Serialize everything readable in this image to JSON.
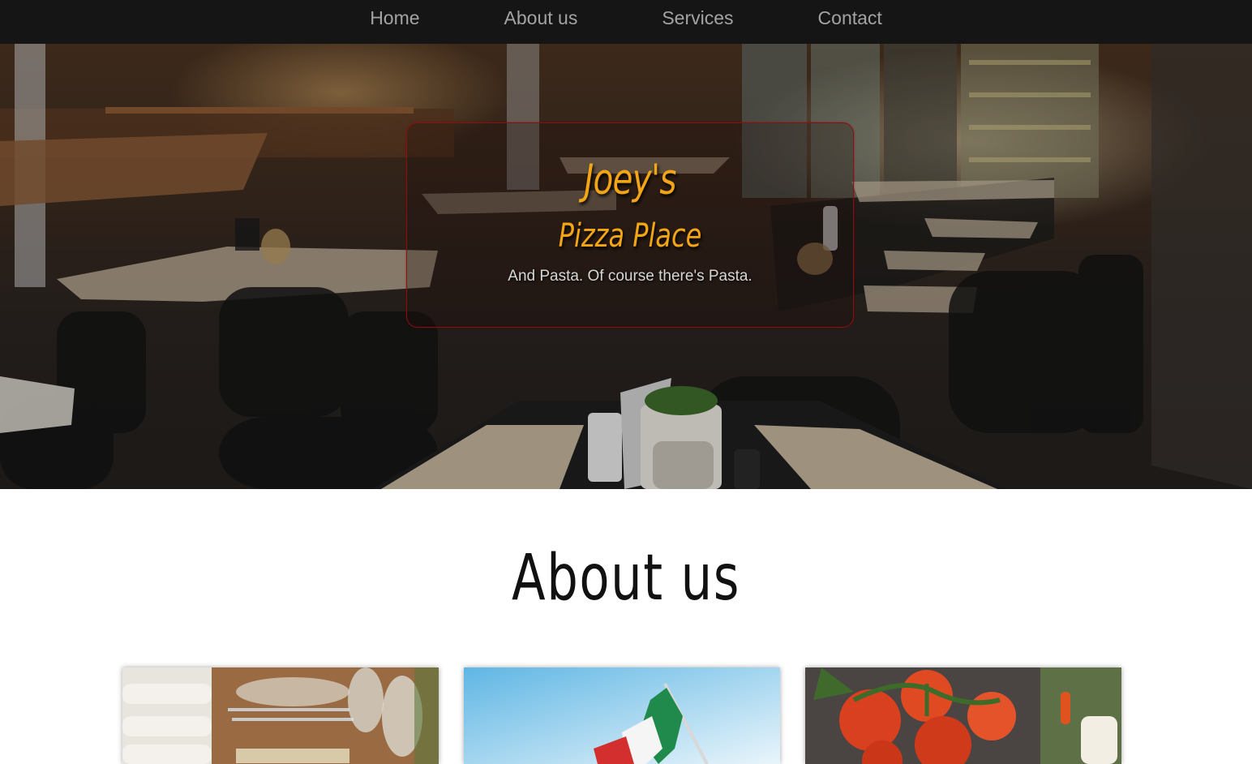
{
  "nav": {
    "items": [
      {
        "label": "Home"
      },
      {
        "label": "About us"
      },
      {
        "label": "Services"
      },
      {
        "label": "Contact"
      }
    ]
  },
  "hero": {
    "title": "Joey's",
    "subtitle": "Pizza Place",
    "tagline": "And Pasta. Of course there's Pasta."
  },
  "about": {
    "heading": "About us",
    "cards": [
      {
        "image": "table-setting-photo"
      },
      {
        "image": "italian-flag-photo"
      },
      {
        "image": "tomatoes-photo"
      }
    ]
  },
  "colors": {
    "navbar_bg": "#161515",
    "nav_text": "#a3a3a3",
    "accent": "#f2a515",
    "card_border": "#8b1010"
  }
}
